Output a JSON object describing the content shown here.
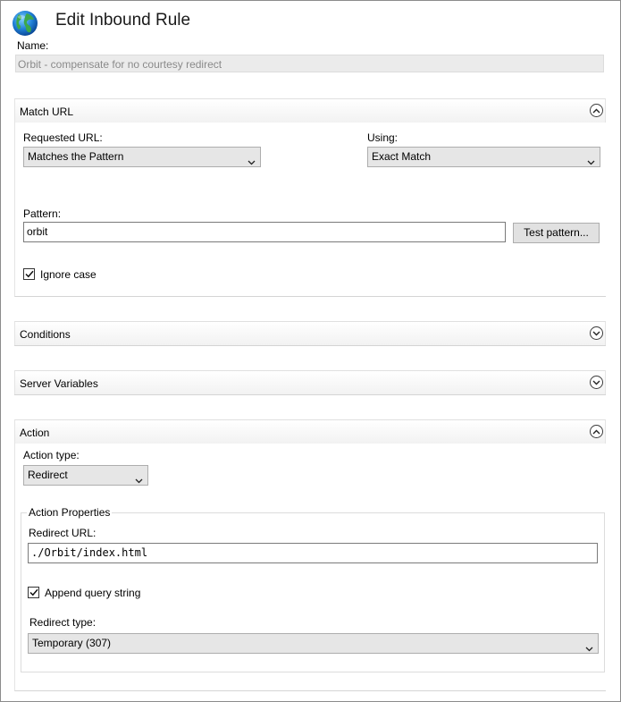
{
  "window": {
    "title": "Edit Inbound Rule",
    "icon": "globe-icon"
  },
  "name": {
    "label": "Name:",
    "value": "Orbit - compensate for no courtesy redirect"
  },
  "match_url": {
    "header": "Match URL",
    "requested_url_label": "Requested URL:",
    "requested_url_value": "Matches the Pattern",
    "using_label": "Using:",
    "using_value": "Exact Match",
    "pattern_label": "Pattern:",
    "pattern_value": "orbit",
    "test_pattern_button": "Test pattern...",
    "ignore_case_label": "Ignore case",
    "ignore_case_checked": true
  },
  "conditions": {
    "header": "Conditions"
  },
  "server_variables": {
    "header": "Server Variables"
  },
  "action": {
    "header": "Action",
    "action_type_label": "Action type:",
    "action_type_value": "Redirect",
    "properties_title": "Action Properties",
    "redirect_url_label": "Redirect URL:",
    "redirect_url_value": "./Orbit/index.html",
    "append_query_label": "Append query string",
    "append_query_checked": true,
    "redirect_type_label": "Redirect type:",
    "redirect_type_value": "Temporary (307)"
  },
  "colors": {
    "accent": "#0078d7",
    "select_bg": "#e6e6e6",
    "readonly_bg": "#ebebeb"
  }
}
